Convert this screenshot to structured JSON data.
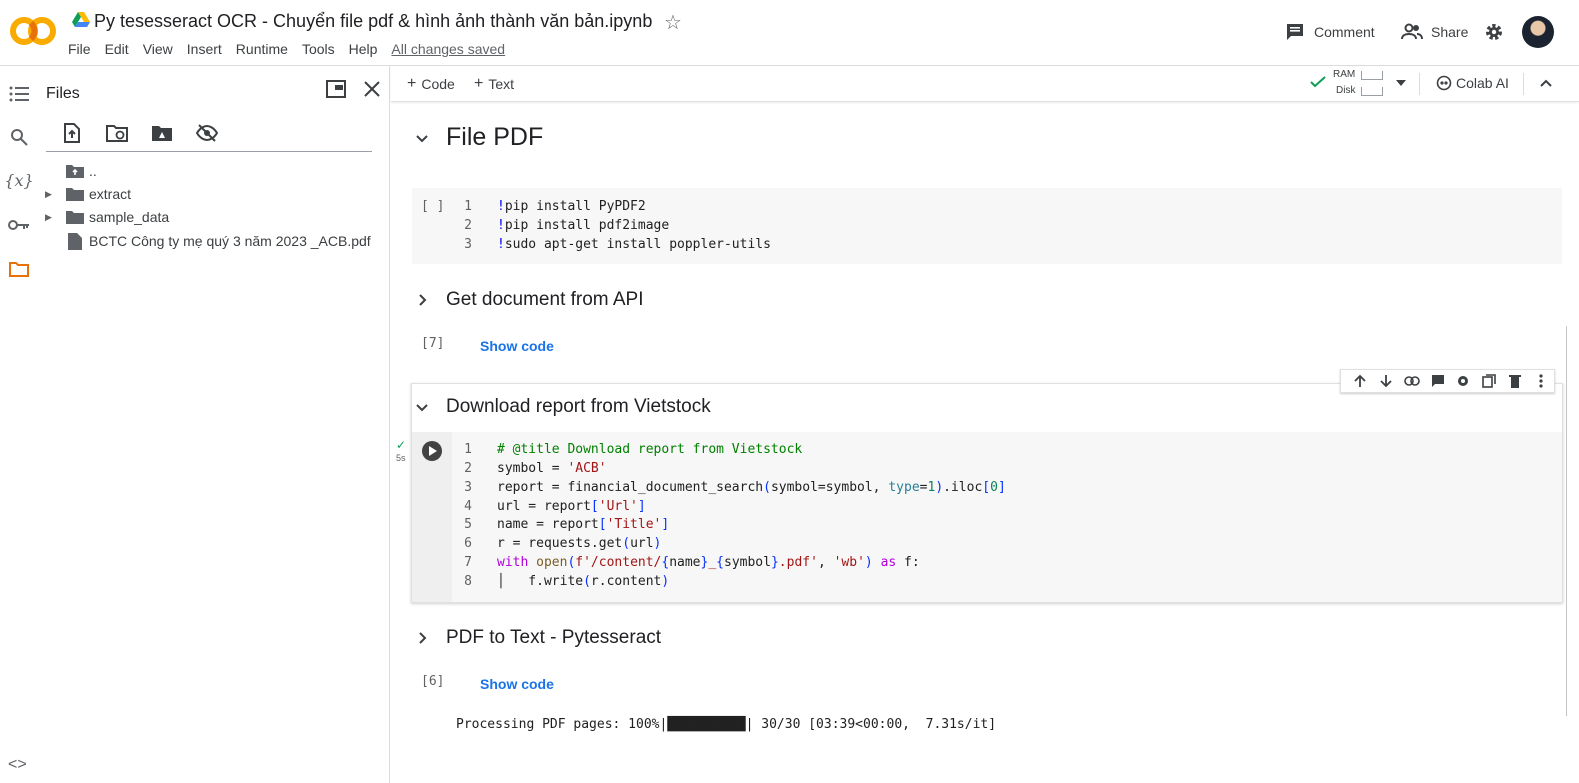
{
  "header": {
    "logo_text": "CO",
    "title": "Py tesesseract OCR - Chuyển file pdf & hình ảnh thành văn bản.ipynb",
    "menu": [
      "File",
      "Edit",
      "View",
      "Insert",
      "Runtime",
      "Tools",
      "Help"
    ],
    "saved_status": "All changes saved",
    "comment_label": "Comment",
    "share_label": "Share",
    "colors": {
      "logo_orange": "#f9ab00",
      "accent": "#1a73e8"
    }
  },
  "rail": {
    "icons": [
      "toc-icon",
      "search-icon",
      "variables-icon",
      "secrets-key-icon",
      "folder-icon"
    ],
    "bottom_icon": "<>"
  },
  "files": {
    "title": "Files",
    "tree": [
      {
        "name": "..",
        "type": "up"
      },
      {
        "name": "extract",
        "type": "folder"
      },
      {
        "name": "sample_data",
        "type": "folder"
      },
      {
        "name": "BCTC Công ty mẹ quý 3 năm 2023 _ACB.pdf",
        "type": "file"
      }
    ]
  },
  "toolbar": {
    "add_code": "Code",
    "add_text": "Text",
    "ram": "RAM",
    "disk": "Disk",
    "colab_ai": "Colab AI"
  },
  "notebook": {
    "h1": "File PDF",
    "cell1": {
      "exec": "[ ]",
      "lines": [
        "1",
        "2",
        "3"
      ]
    },
    "h2": "Get document from API",
    "cell2": {
      "exec": "[7]",
      "show_code": "Show code"
    },
    "h3": "Download report from Vietstock",
    "cell3": {
      "check": "✓",
      "time": "5s",
      "lines": [
        "1",
        "2",
        "3",
        "4",
        "5",
        "6",
        "7",
        "8"
      ]
    },
    "h4": "PDF to Text - Pytesseract",
    "cell4": {
      "exec": "[6]",
      "show_code": "Show code",
      "output_prefix": "Processing PDF pages: 100%|",
      "output_bar": "██████████",
      "output_suffix": "| 30/30 [03:39<00:00,  7.31s/it]"
    }
  }
}
